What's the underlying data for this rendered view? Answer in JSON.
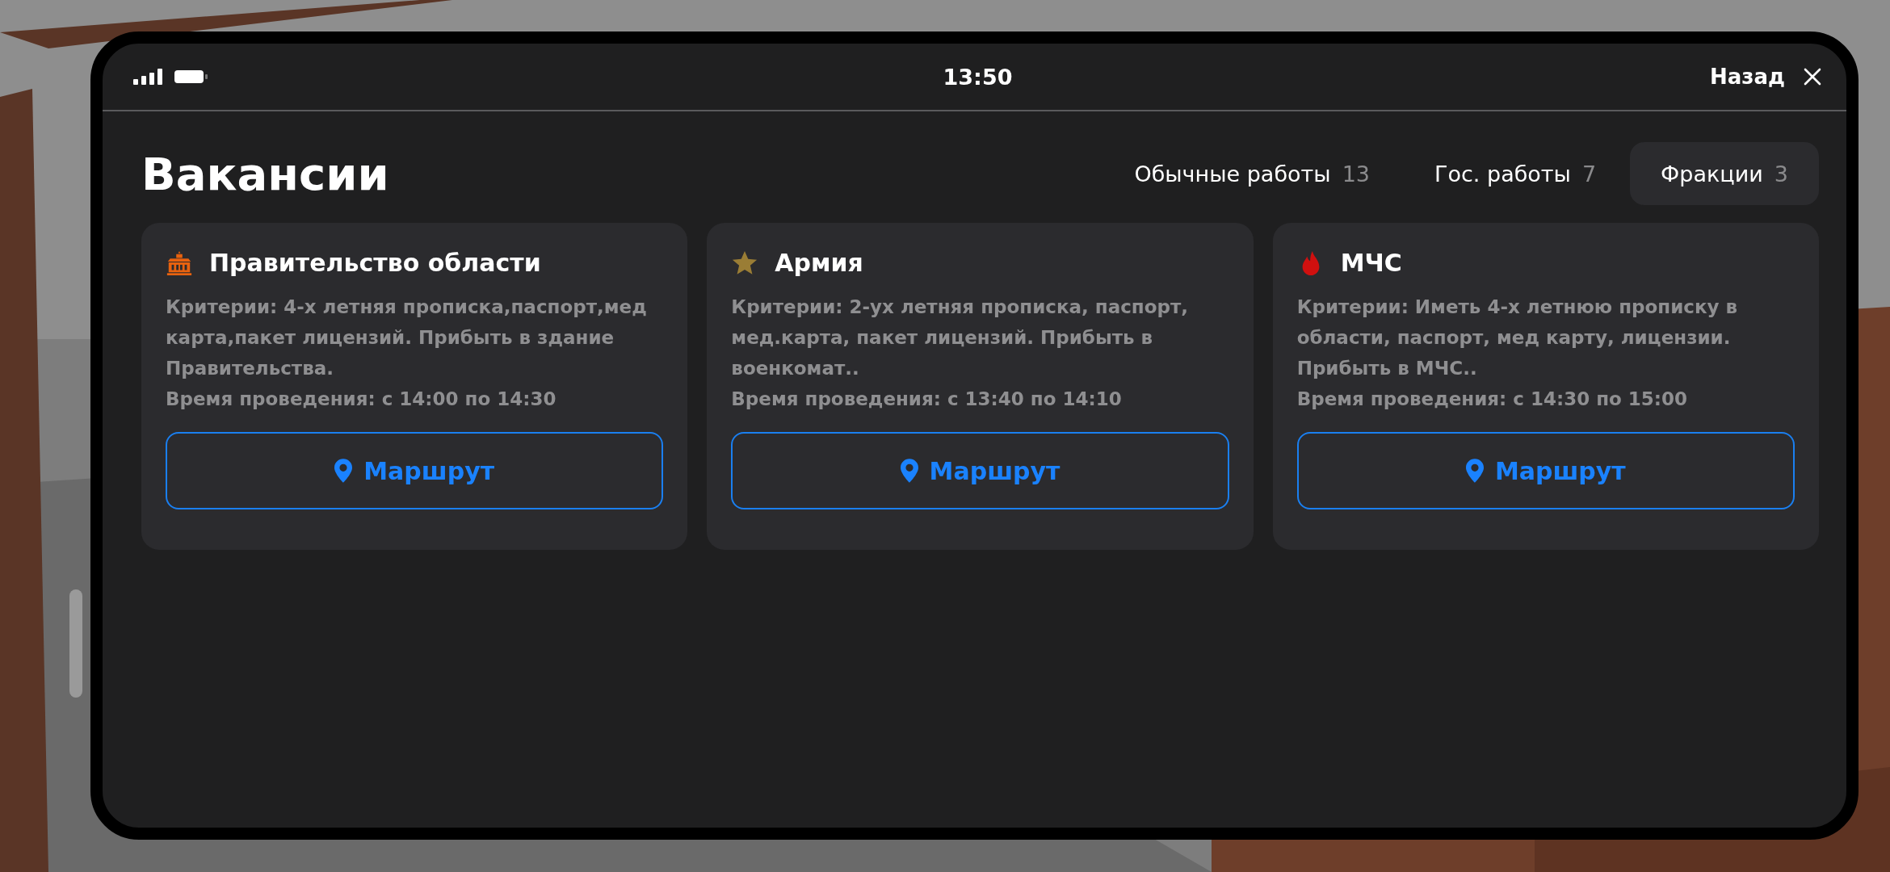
{
  "status_bar": {
    "time": "13:50",
    "back_label": "Назад"
  },
  "title": "Вакансии",
  "tabs": [
    {
      "label": "Обычные работы",
      "count": "13",
      "selected": false
    },
    {
      "label": "Гос. работы",
      "count": "7",
      "selected": false
    },
    {
      "label": "Фракции",
      "count": "3",
      "selected": true
    }
  ],
  "cards": [
    {
      "kind": "building",
      "title": "Правительство области",
      "criteria": "Критерии: 4-х летняя прописка,паспорт,мед карта,пакет лицензий. Прибыть в здание Правительства.",
      "schedule": "Время проведения: с 14:00 по 14:30",
      "button": "Маршрут"
    },
    {
      "kind": "star",
      "title": "Армия",
      "criteria": "Критерии: 2-ух летняя прописка, паспорт, мед.карта, пакет лицензий. Прибыть в военкомат..",
      "schedule": "Время проведения: с 13:40 по 14:10",
      "button": "Маршрут"
    },
    {
      "kind": "flame",
      "title": "МЧС",
      "criteria": "Критерии: Иметь 4-х летнюю прописку в области, паспорт, мед карту, лицензии. Прибыть в МЧС..",
      "schedule": "Время проведения: с 14:30 по 15:00",
      "button": "Маршрут"
    }
  ]
}
